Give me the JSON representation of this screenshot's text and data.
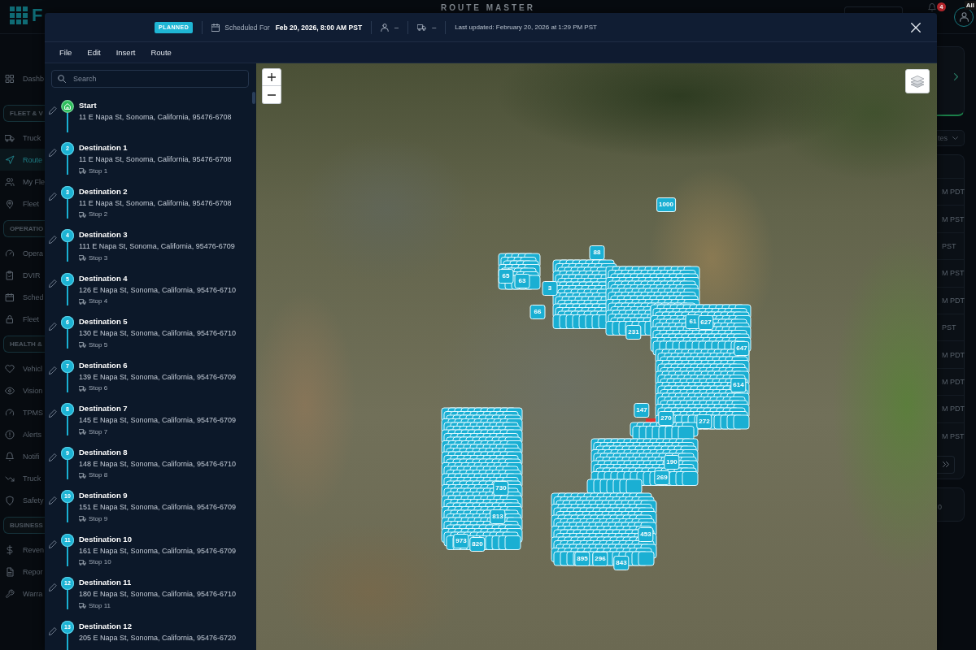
{
  "app": {
    "logo_text": "F",
    "title": "ROUTE MASTER",
    "notification_count": "4",
    "tooltip": "All"
  },
  "sidebar": {
    "items": [
      {
        "label": "Dashb",
        "selected": false
      }
    ],
    "sections": [
      {
        "label": "FLEET & V",
        "items": [
          {
            "label": "Truck",
            "selected": false
          },
          {
            "label": "Route",
            "selected": true
          },
          {
            "label": "My Fle",
            "selected": false
          },
          {
            "label": "Fleet",
            "selected": false
          }
        ]
      },
      {
        "label": "OPERATIO",
        "items": [
          {
            "label": "Opera",
            "selected": false
          },
          {
            "label": "DVIR",
            "selected": false
          },
          {
            "label": "Sched",
            "selected": false
          },
          {
            "label": "Fleet",
            "selected": false
          }
        ]
      },
      {
        "label": "HEALTH &",
        "items": [
          {
            "label": "Vehicl",
            "selected": false
          },
          {
            "label": "Vision",
            "selected": false
          },
          {
            "label": "TPMS",
            "selected": false
          },
          {
            "label": "Alerts",
            "selected": false
          },
          {
            "label": "Notifi",
            "selected": false
          },
          {
            "label": "Truck",
            "selected": false
          },
          {
            "label": "Safety",
            "selected": false
          }
        ]
      },
      {
        "label": "BUSINESS",
        "items": [
          {
            "label": "Reven",
            "selected": false
          },
          {
            "label": "Repor",
            "selected": false
          },
          {
            "label": "Warra",
            "selected": false
          }
        ]
      }
    ]
  },
  "right_panel": {
    "dropdown": "tes",
    "rows": [
      "M PDT",
      "M PST",
      "PST",
      "M PST",
      "M PDT",
      "PST",
      "M PDT",
      "M PDT",
      "M PDT",
      "M PST"
    ],
    "footer": "0"
  },
  "modal": {
    "status": "PLANNED",
    "scheduled_label": "Scheduled For",
    "scheduled_value": "Feb 20, 2026, 8:00 AM PST",
    "driver": "–",
    "vehicle": "–",
    "last_updated": "Last updated: February 20, 2026 at 1:29 PM PST",
    "menu": [
      "File",
      "Edit",
      "Insert",
      "Route"
    ],
    "search": {
      "placeholder": "Search"
    },
    "stops": [
      {
        "kind": "start",
        "title": "Start",
        "address": "11 E Napa St, Sonoma, California, 95476-6708"
      },
      {
        "kind": "destination",
        "marker": "2",
        "title": "Destination 1",
        "address": "11 E Napa St, Sonoma, California, 95476-6708",
        "stop": "Stop 1"
      },
      {
        "kind": "destination",
        "marker": "3",
        "title": "Destination 2",
        "address": "11 E Napa St, Sonoma, California, 95476-6708",
        "stop": "Stop 2"
      },
      {
        "kind": "destination",
        "marker": "4",
        "title": "Destination 3",
        "address": "111 E Napa St, Sonoma, California, 95476-6709",
        "stop": "Stop 3"
      },
      {
        "kind": "destination",
        "marker": "5",
        "title": "Destination 4",
        "address": "126 E Napa St, Sonoma, California, 95476-6710",
        "stop": "Stop 4"
      },
      {
        "kind": "destination",
        "marker": "6",
        "title": "Destination 5",
        "address": "130 E Napa St, Sonoma, California, 95476-6710",
        "stop": "Stop 5"
      },
      {
        "kind": "destination",
        "marker": "7",
        "title": "Destination 6",
        "address": "139 E Napa St, Sonoma, California, 95476-6709",
        "stop": "Stop 6"
      },
      {
        "kind": "destination",
        "marker": "8",
        "title": "Destination 7",
        "address": "145 E Napa St, Sonoma, California, 95476-6709",
        "stop": "Stop 7"
      },
      {
        "kind": "destination",
        "marker": "9",
        "title": "Destination 8",
        "address": "148 E Napa St, Sonoma, California, 95476-6710",
        "stop": "Stop 8"
      },
      {
        "kind": "destination",
        "marker": "10",
        "title": "Destination 9",
        "address": "151 E Napa St, Sonoma, California, 95476-6709",
        "stop": "Stop 9"
      },
      {
        "kind": "destination",
        "marker": "11",
        "title": "Destination 10",
        "address": "161 E Napa St, Sonoma, California, 95476-6709",
        "stop": "Stop 10"
      },
      {
        "kind": "destination",
        "marker": "12",
        "title": "Destination 11",
        "address": "180 E Napa St, Sonoma, California, 95476-6710",
        "stop": "Stop 11"
      },
      {
        "kind": "destination",
        "marker": "13",
        "title": "Destination 12",
        "address": "205 E Napa St, Sonoma, California, 95476-6720"
      }
    ],
    "map": {
      "markers": [
        {
          "label": "1000"
        },
        {
          "label": "88"
        },
        {
          "label": "65"
        },
        {
          "label": "63"
        },
        {
          "label": "3"
        },
        {
          "label": "66"
        },
        {
          "label": "231"
        },
        {
          "label": "61"
        },
        {
          "label": "627"
        },
        {
          "label": "647"
        },
        {
          "label": "614"
        },
        {
          "label": "147"
        },
        {
          "label": "270"
        },
        {
          "label": "272"
        },
        {
          "label": "190"
        },
        {
          "label": "269"
        },
        {
          "label": "730"
        },
        {
          "label": "813"
        },
        {
          "label": "973"
        },
        {
          "label": "820"
        },
        {
          "label": "453"
        },
        {
          "label": "895"
        },
        {
          "label": "296"
        },
        {
          "label": "843"
        }
      ]
    }
  }
}
